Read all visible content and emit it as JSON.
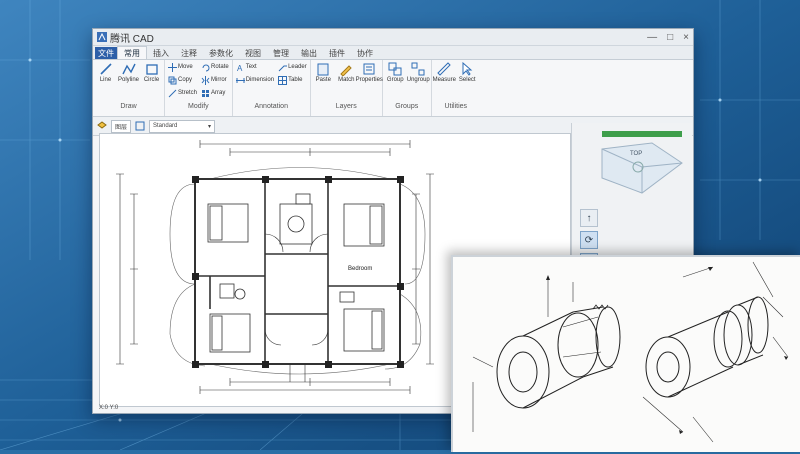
{
  "app": {
    "title": "腾讯 CAD"
  },
  "window_controls": {
    "minimize": "—",
    "maximize": "□",
    "close": "×"
  },
  "file_tab": "文件",
  "tabs": [
    "常用",
    "插入",
    "注释",
    "参数化",
    "视图",
    "管理",
    "输出",
    "插件",
    "协作"
  ],
  "ribbon": {
    "groups": [
      {
        "name": "draw",
        "label": "Draw",
        "tools": [
          "Line",
          "Polyline",
          "Circle"
        ]
      },
      {
        "name": "modify",
        "label": "Modify",
        "tools": [
          "Move",
          "Copy",
          "Stretch",
          "Rotate",
          "Mirror",
          "Array"
        ]
      },
      {
        "name": "annotation",
        "label": "Annotation",
        "tools": [
          "Text",
          "Dimension",
          "Leader",
          "Table"
        ]
      },
      {
        "name": "layers",
        "label": "Layers",
        "tools": [
          "Paste",
          "Match",
          "Properties"
        ]
      },
      {
        "name": "groups",
        "label": "Groups",
        "tools": [
          "Group",
          "Ungroup"
        ]
      },
      {
        "name": "utilities",
        "label": "Utilities",
        "tools": [
          "Measure",
          "Select"
        ]
      }
    ]
  },
  "toolbar2": {
    "layer": "图层",
    "style": "Standard"
  },
  "drawing": {
    "room_label": "Bedroom",
    "status": "X:0 Y:0"
  },
  "nav": {
    "up": "↑",
    "orbit": "⟳",
    "pan": "∫",
    "down": "↓"
  },
  "view_cube": {
    "label": "TOP"
  }
}
